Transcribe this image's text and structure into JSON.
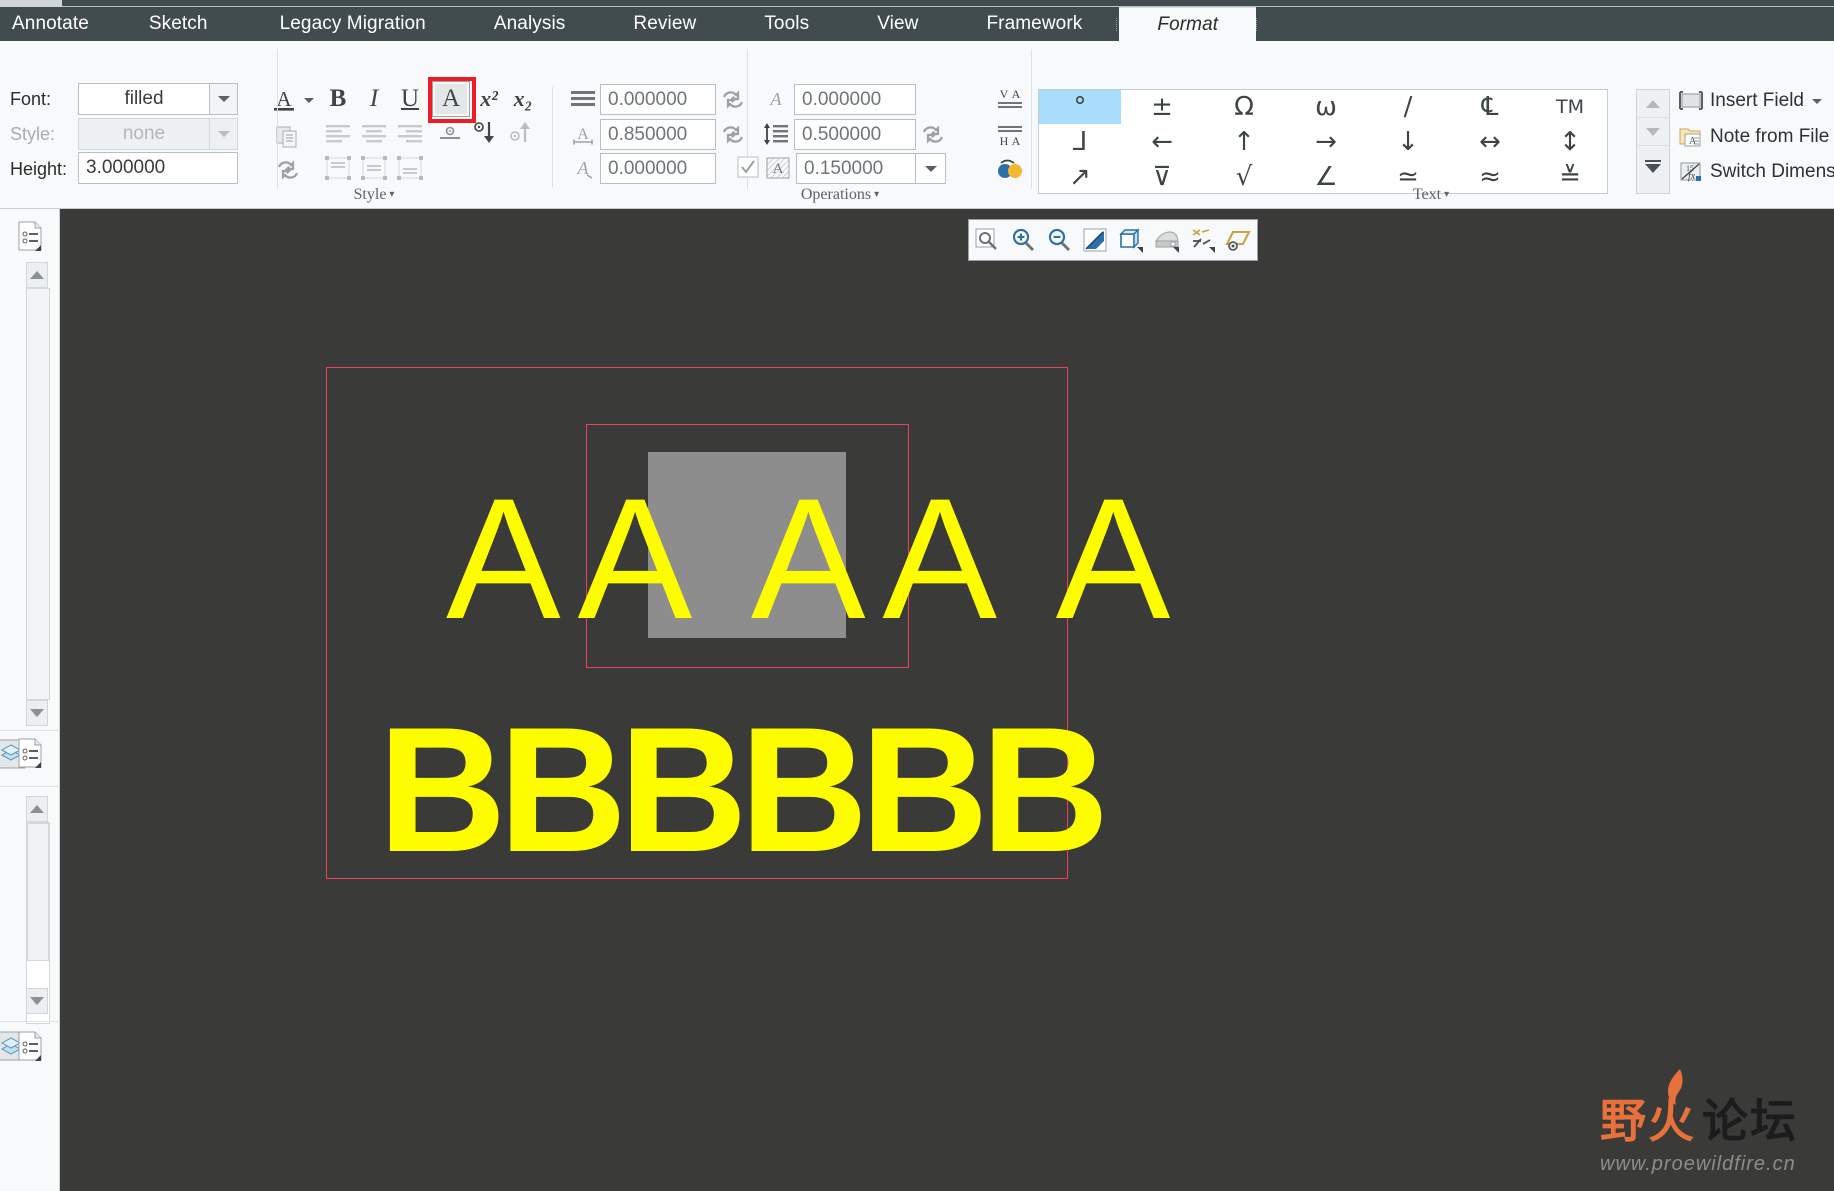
{
  "window": {
    "active_tab": "Format"
  },
  "ribbon": {
    "tabs": [
      {
        "label": "Annotate",
        "active": false
      },
      {
        "label": "Sketch",
        "active": false
      },
      {
        "label": "Legacy Migration",
        "active": false
      },
      {
        "label": "Analysis",
        "active": false
      },
      {
        "label": "Review",
        "active": false
      },
      {
        "label": "Tools",
        "active": false
      },
      {
        "label": "View",
        "active": false
      },
      {
        "label": "Framework",
        "active": false
      },
      {
        "label": "Format",
        "active": true
      }
    ],
    "groups": {
      "style": {
        "label": "Style",
        "caret": "▾"
      },
      "operations": {
        "label": "Operations",
        "caret": "▾"
      },
      "text": {
        "label": "Text",
        "caret": "▾"
      }
    },
    "font_panel": {
      "font_label": "Font:",
      "font_value": "filled",
      "style_label": "Style:",
      "style_value": "none",
      "height_label": "Height:",
      "height_value": "3.000000"
    },
    "style_group": {
      "bold": "B",
      "italic": "I",
      "underline": "U",
      "textstyle": "A",
      "superscript": "x²",
      "subscript": "x₂",
      "line_spacing_value": "0.000000",
      "text_width_value": "0.850000",
      "slant_angle_value": "0.000000"
    },
    "operations_group": {
      "char_angle_value": "0.000000",
      "line_spacing_value": "0.500000",
      "margin_value": "0.150000",
      "margin_checked": true
    },
    "symbols": [
      [
        "°",
        "±",
        "Ω",
        "ω",
        "/",
        "℄",
        "TM"
      ],
      [
        "⅃",
        "←",
        "↑",
        "→",
        "↓",
        "↔",
        "↕"
      ],
      [
        "↗",
        "⊥",
        "√",
        "∠",
        "≃",
        "≈",
        "≐"
      ]
    ],
    "symbol_selected": "°",
    "text_actions": [
      {
        "label": "Insert Field",
        "icon": "insert-field-icon",
        "has_caret": true
      },
      {
        "label": "Note from File",
        "icon": "note-from-file-icon",
        "has_caret": false
      },
      {
        "label": "Switch Dimensi",
        "icon": "switch-dimension-icon",
        "has_caret": false
      }
    ]
  },
  "floating_toolbar": {
    "buttons": [
      {
        "name": "zoom-area-icon"
      },
      {
        "name": "zoom-in-icon"
      },
      {
        "name": "zoom-out-icon"
      },
      {
        "name": "refit-icon"
      },
      {
        "name": "display-style-icon"
      },
      {
        "name": "appearance-icon"
      },
      {
        "name": "datum-display-icon"
      },
      {
        "name": "annotation-display-icon"
      }
    ]
  },
  "left_dock": {
    "panes": [
      {
        "icon": "model-tree-icon"
      },
      {
        "icon": "model-tree-icon"
      },
      {
        "icon": "model-tree-icon"
      }
    ],
    "layer_icon": "layer-icon"
  },
  "canvas": {
    "note_line_1": "A A  A A  A",
    "note_line_2": "BBBBBB",
    "text_color": "#fdfd00",
    "selection_border_color": "#e8435a",
    "highlight_color": "#8d8d8d",
    "background_color": "#3a3a38"
  },
  "watermark": {
    "chinese": "野火论坛",
    "url": "www.proewildfire.cn",
    "accent_color": "#e8703a"
  }
}
